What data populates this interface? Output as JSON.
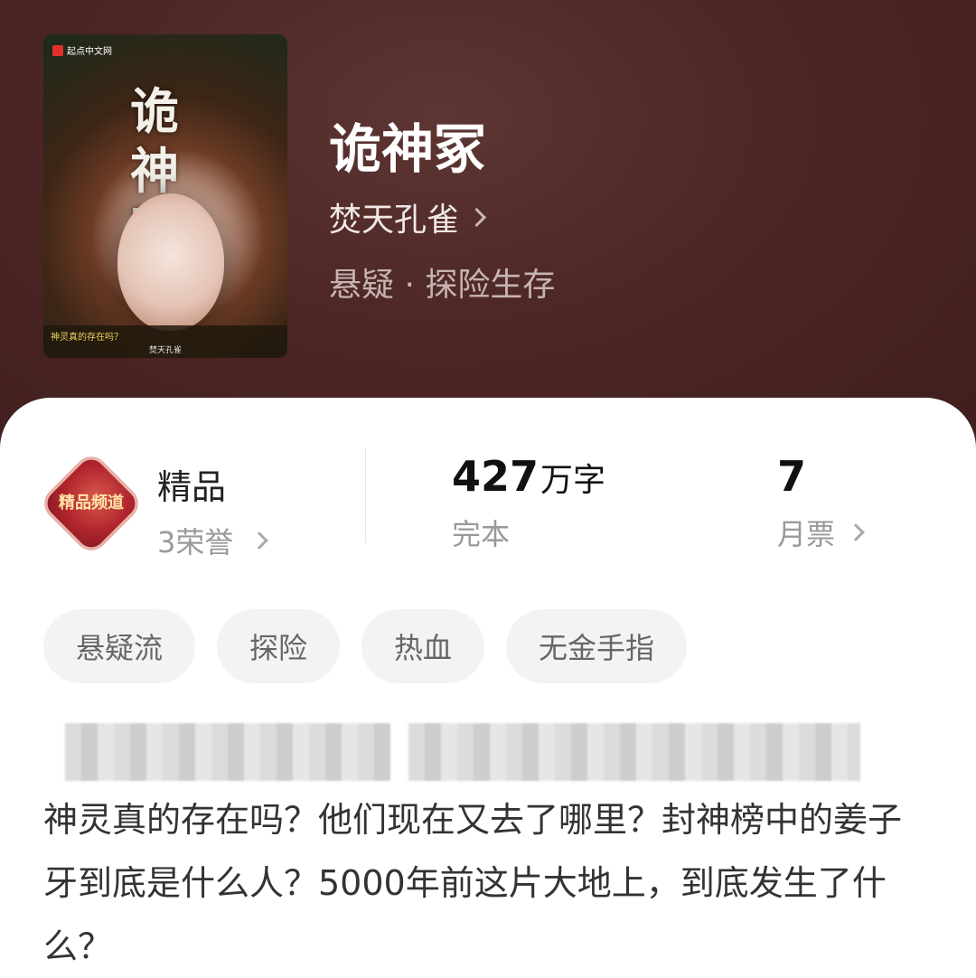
{
  "cover": {
    "brand": "起点中文网",
    "title": "诡神冢",
    "tagline": "神灵真的存在吗？",
    "author": "焚天孔雀"
  },
  "book": {
    "title": "诡神冢",
    "author": "焚天孔雀",
    "genre": "悬疑 · 探险生存"
  },
  "stats": {
    "honor": {
      "badge_text": "精品频道",
      "label": "精品",
      "sub": "3荣誉"
    },
    "words": {
      "value": "427",
      "unit": "万字",
      "sub": "完本"
    },
    "tickets": {
      "value": "7",
      "sub": "月票"
    }
  },
  "tags": [
    "悬疑流",
    "探险",
    "热血",
    "无金手指"
  ],
  "synopsis": "神灵真的存在吗？他们现在又去了哪里？封神榜中的姜子牙到底是什么人？5000年前这片大地上，到底发生了什么？",
  "colors": {
    "header_bg": "#4c2624",
    "card_bg": "#ffffff",
    "tag_bg": "#f3f3f3"
  }
}
